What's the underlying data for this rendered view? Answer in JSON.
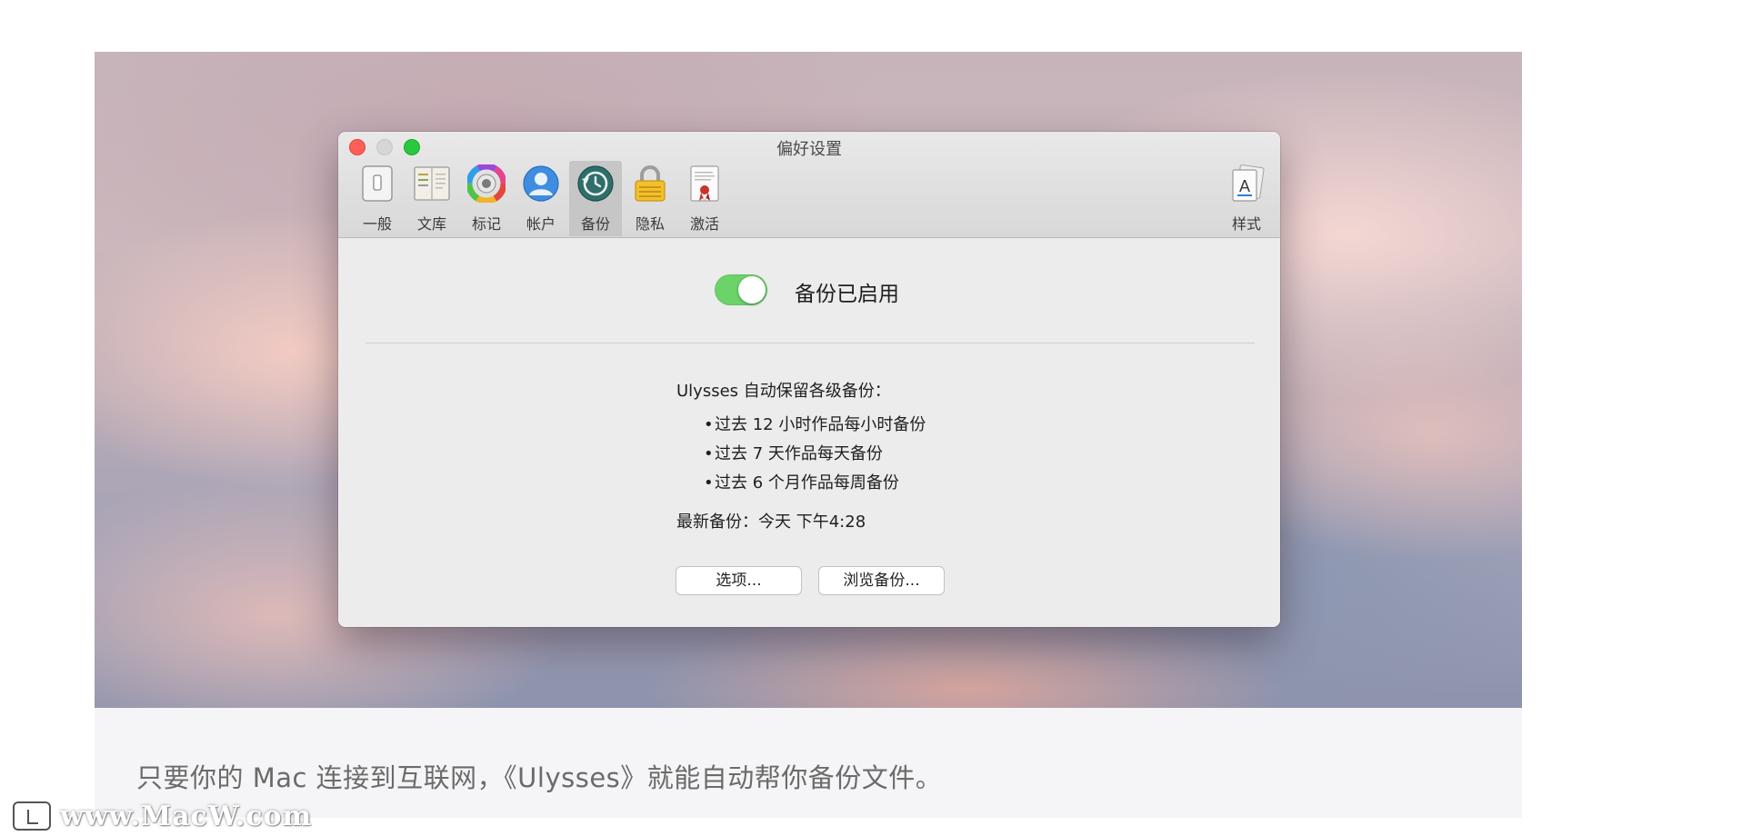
{
  "window": {
    "title": "偏好设置"
  },
  "toolbar": {
    "items": [
      {
        "label": "一般",
        "icon": "general-switch-icon"
      },
      {
        "label": "文库",
        "icon": "library-book-icon"
      },
      {
        "label": "标记",
        "icon": "color-wheel-icon"
      },
      {
        "label": "帐户",
        "icon": "account-user-icon"
      },
      {
        "label": "备份",
        "icon": "backup-clock-icon",
        "selected": true
      },
      {
        "label": "隐私",
        "icon": "privacy-lock-icon"
      },
      {
        "label": "激活",
        "icon": "activation-certificate-icon"
      },
      {
        "label": "样式",
        "icon": "style-document-icon"
      }
    ]
  },
  "backup": {
    "toggle_label": "备份已启用",
    "toggle_on": true,
    "info_title": "Ulysses 自动保留各级备份：",
    "bullets": [
      "过去 12 小时作品每小时备份",
      "过去 7 天作品每天备份",
      "过去 6 个月作品每周备份"
    ],
    "latest": "最新备份：今天 下午4:28",
    "options_button": "选项...",
    "browse_button": "浏览备份..."
  },
  "caption": "只要你的 Mac 连接到互联网，《Ulysses》就能自动帮你备份文件。",
  "watermark": "www.MacW.com",
  "colors": {
    "toggle_on": "#6cd26a",
    "close": "#ff5f57",
    "zoom": "#28c840"
  }
}
